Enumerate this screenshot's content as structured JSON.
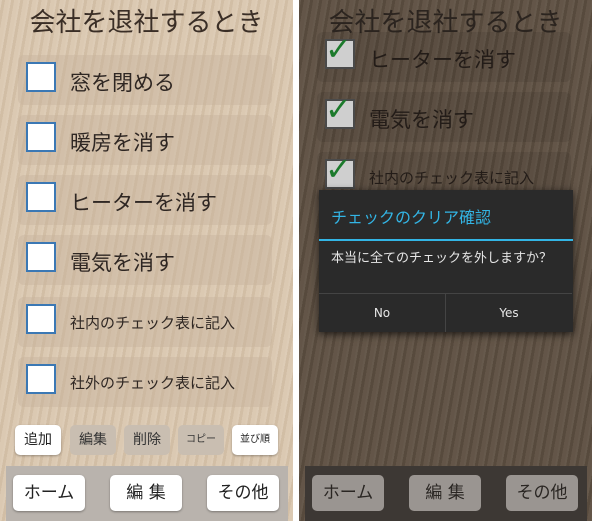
{
  "left": {
    "title": "会社を退社するとき",
    "items": [
      {
        "label": "窓を閉める",
        "checked": false
      },
      {
        "label": "暖房を消す",
        "checked": false
      },
      {
        "label": "ヒーターを消す",
        "checked": false
      },
      {
        "label": "電気を消す",
        "checked": false
      },
      {
        "label": "社内のチェック表に記入",
        "checked": false
      },
      {
        "label": "社外のチェック表に記入",
        "checked": false
      }
    ],
    "actions": {
      "add": "追加",
      "edit": "編集",
      "delete": "削除",
      "copy": "コピー",
      "sort": "並び順"
    },
    "bottom": {
      "home": "ホーム",
      "edit": "編 集",
      "other": "その他"
    }
  },
  "right": {
    "title": "会社を退社するとき",
    "items": [
      {
        "label": "ヒーターを消す",
        "checked": true
      },
      {
        "label": "電気を消す",
        "checked": true
      },
      {
        "label": "社内のチェック表に記入",
        "checked": true
      }
    ],
    "dialog": {
      "title": "チェックのクリア確認",
      "message": "本当に全てのチェックを外しますか？",
      "no": "No",
      "yes": "Yes"
    },
    "bottom": {
      "home": "ホーム",
      "edit": "編 集",
      "other": "その他"
    }
  },
  "colors": {
    "checkbox_border": "#3b78b4",
    "check_mark": "#1c7a2c",
    "dialog_accent": "#33b5e5"
  }
}
